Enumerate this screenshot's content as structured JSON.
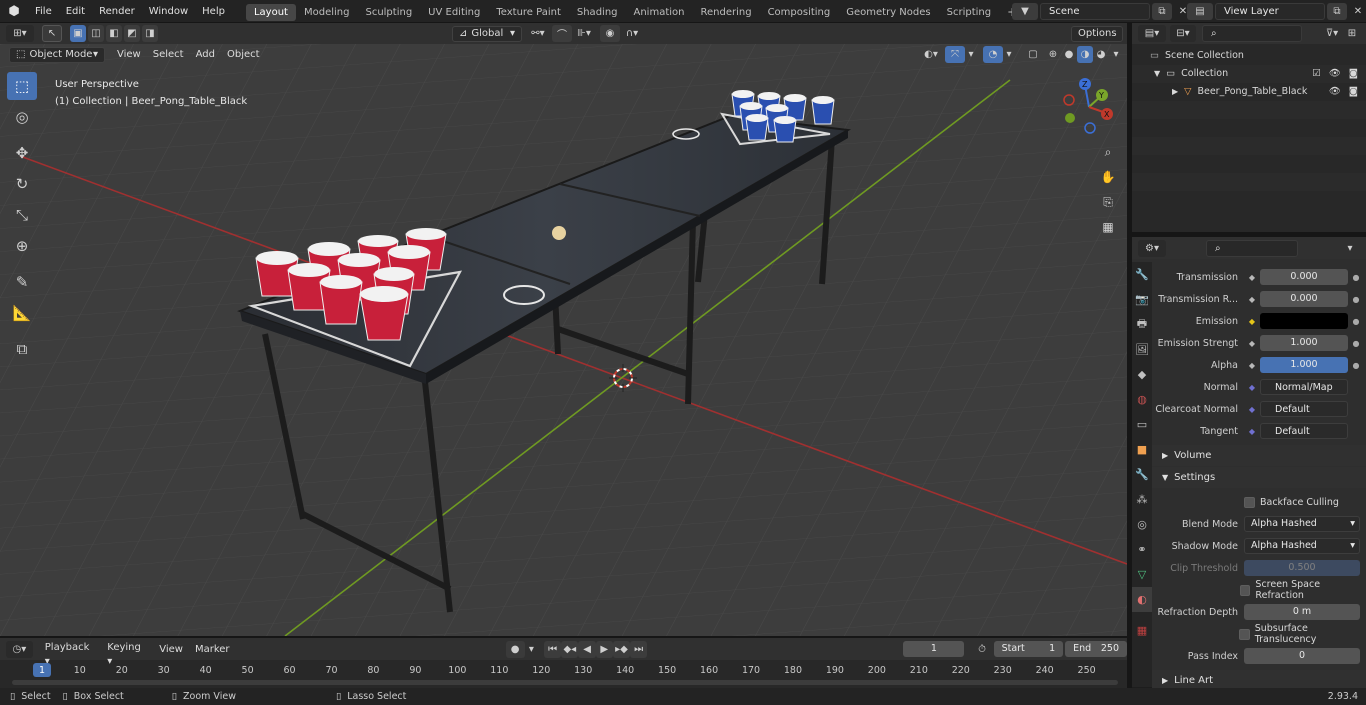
{
  "topbar": {
    "menus": [
      "File",
      "Edit",
      "Render",
      "Window",
      "Help"
    ],
    "workspaces": [
      "Layout",
      "Modeling",
      "Sculpting",
      "UV Editing",
      "Texture Paint",
      "Shading",
      "Animation",
      "Rendering",
      "Compositing",
      "Geometry Nodes",
      "Scripting"
    ],
    "active_workspace": "Layout",
    "add_tab": "+",
    "scene": "Scene",
    "view_layer": "View Layer"
  },
  "viewport_header": {
    "mode": "Object Mode",
    "menus": [
      "View",
      "Select",
      "Add",
      "Object"
    ],
    "orientation": "Global",
    "options": "Options"
  },
  "viewport": {
    "perspective": "User Perspective",
    "collection": "(1) Collection | Beer_Pong_Table_Black",
    "gizmo_axes": [
      "Z",
      "Y",
      "X"
    ]
  },
  "outliner": {
    "items": [
      "Scene Collection",
      "Collection",
      "Beer_Pong_Table_Black"
    ]
  },
  "properties": {
    "rows": [
      {
        "label": "Transmission",
        "value": "0.000",
        "kind": "num"
      },
      {
        "label": "Transmission R...",
        "value": "0.000",
        "kind": "num"
      },
      {
        "label": "Emission",
        "value": "",
        "kind": "color"
      },
      {
        "label": "Emission Strengt",
        "value": "1.000",
        "kind": "num"
      },
      {
        "label": "Alpha",
        "value": "1.000",
        "kind": "blue"
      },
      {
        "label": "Normal",
        "value": "Normal/Map",
        "kind": "link"
      },
      {
        "label": "Clearcoat Normal",
        "value": "Default",
        "kind": "link"
      },
      {
        "label": "Tangent",
        "value": "Default",
        "kind": "link"
      }
    ],
    "volume": "Volume",
    "settings": "Settings",
    "backface_culling": "Backface Culling",
    "blend_mode_label": "Blend Mode",
    "blend_mode": "Alpha Hashed",
    "shadow_mode_label": "Shadow Mode",
    "shadow_mode": "Alpha Hashed",
    "clip_threshold_label": "Clip Threshold",
    "clip_threshold": "0.500",
    "ssr": "Screen Space Refraction",
    "refraction_depth_label": "Refraction Depth",
    "refraction_depth": "0 m",
    "sss": "Subsurface Translucency",
    "pass_index_label": "Pass Index",
    "pass_index": "0",
    "line_art": "Line Art"
  },
  "timeline": {
    "menus": [
      "Playback",
      "Keying",
      "View",
      "Marker"
    ],
    "current_frame": "1",
    "start_label": "Start",
    "start": "1",
    "end_label": "End",
    "end": "250",
    "ticks": [
      "1",
      "10",
      "20",
      "30",
      "40",
      "50",
      "60",
      "70",
      "80",
      "90",
      "100",
      "110",
      "120",
      "130",
      "140",
      "150",
      "160",
      "170",
      "180",
      "190",
      "200",
      "210",
      "220",
      "230",
      "240",
      "250"
    ]
  },
  "statusbar": {
    "select": "Select",
    "box_select": "Box Select",
    "zoom_view": "Zoom View",
    "lasso_select": "Lasso Select",
    "version": "2.93.4"
  },
  "colors": {
    "accent": "#4772b3",
    "x_axis": "#c0392b",
    "y_axis": "#7aa62a",
    "cup_red": "#c8203a",
    "cup_blue": "#2a4fb0"
  }
}
